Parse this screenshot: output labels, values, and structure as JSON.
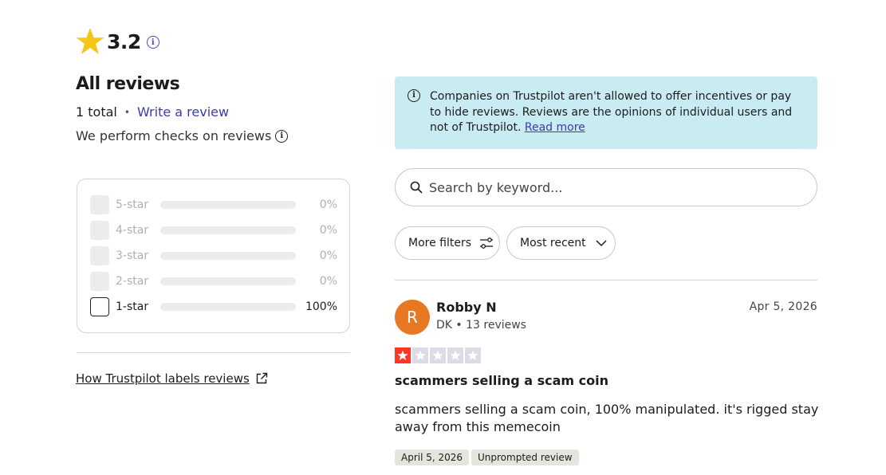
{
  "rating": {
    "score": "3.2",
    "star_icon": "star-icon",
    "star_color": "#f5c518"
  },
  "summary": {
    "heading": "All reviews",
    "total": "1 total",
    "separator": "•",
    "write_review": "Write a review",
    "checks": "We perform checks on reviews"
  },
  "distribution": [
    {
      "label": "5-star",
      "percent": "0%",
      "fraction": 0,
      "active": false
    },
    {
      "label": "4-star",
      "percent": "0%",
      "fraction": 0,
      "active": false
    },
    {
      "label": "3-star",
      "percent": "0%",
      "fraction": 0,
      "active": false
    },
    {
      "label": "2-star",
      "percent": "0%",
      "fraction": 0,
      "active": false
    },
    {
      "label": "1-star",
      "percent": "100%",
      "fraction": 1,
      "active": true
    }
  ],
  "how_link": "How Trustpilot labels reviews",
  "notice": {
    "text": "Companies on Trustpilot aren't allowed to offer incentives or pay to hide reviews. Reviews are the opinions of individual users and not of Trustpilot.",
    "read_more": "Read more",
    "background": "#c9ebf2"
  },
  "search": {
    "placeholder": "Search by keyword..."
  },
  "filters": {
    "more_filters": "More filters",
    "sort": "Most recent"
  },
  "review": {
    "avatar_initial": "R",
    "avatar_color": "#e87722",
    "name": "Robby N",
    "meta": "DK • 13 reviews",
    "date": "Apr 5, 2026",
    "stars": 1,
    "star_on_color": "#ff3722",
    "title": "scammers selling a scam coin",
    "body": "scammers selling a scam coin, 100% manipulated. it's rigged stay away from this memecoin",
    "tags": [
      "April 5, 2026",
      "Unprompted review"
    ]
  }
}
